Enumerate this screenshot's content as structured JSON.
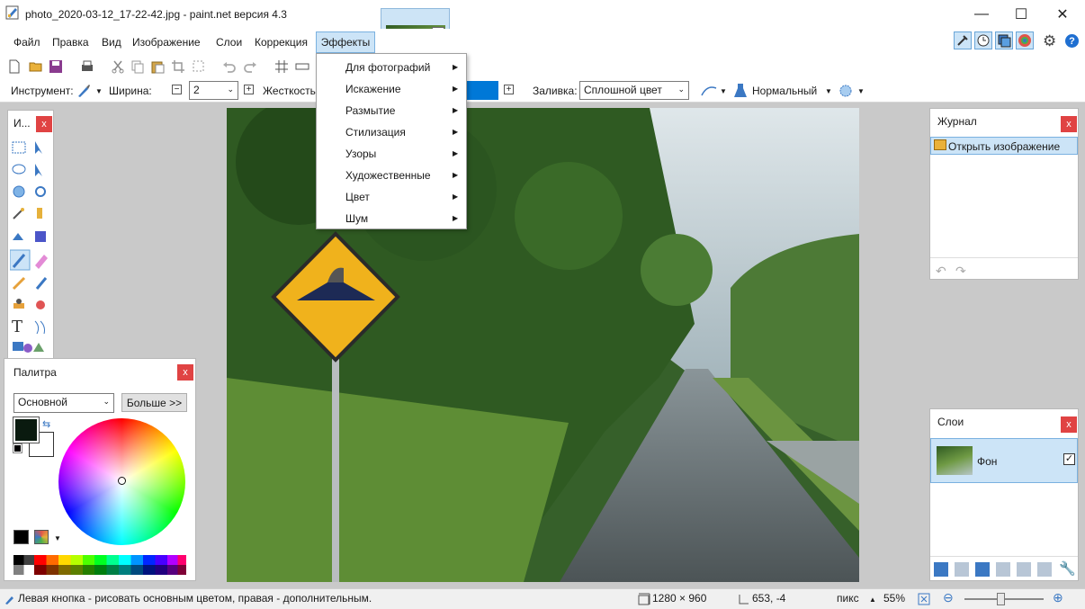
{
  "window": {
    "title": "photo_2020-03-12_17-22-42.jpg - paint.net версия 4.3",
    "controls": {
      "minimize": "—",
      "maximize": "☐",
      "close": "✕"
    }
  },
  "menu": {
    "items": [
      "Файл",
      "Правка",
      "Вид",
      "Изображение",
      "Слои",
      "Коррекция",
      "Эффекты"
    ],
    "active": "Эффекты"
  },
  "effects_menu": {
    "items": [
      {
        "label": "Для фотографий"
      },
      {
        "label": "Искажение"
      },
      {
        "label": "Размытие"
      },
      {
        "label": "Стилизация"
      },
      {
        "label": "Узоры"
      },
      {
        "label": "Художественные"
      },
      {
        "label": "Цвет"
      },
      {
        "label": "Шум"
      }
    ]
  },
  "toolbar2": {
    "tool_label": "Инструмент:",
    "width_label": "Ширина:",
    "width_value": "2",
    "hardness_label": "Жесткость",
    "fill_label": "Заливка:",
    "fill_value": "Сплошной цвет",
    "blend_value": "Нормальный"
  },
  "tools_panel": {
    "title": "И..."
  },
  "palette_panel": {
    "title": "Палитра",
    "palette_select": "Основной",
    "more_button": "Больше >>"
  },
  "history_panel": {
    "title": "Журнал",
    "items": [
      "Открыть изображение"
    ]
  },
  "layers_panel": {
    "title": "Слои",
    "layers": [
      {
        "name": "Фон",
        "visible": true
      }
    ]
  },
  "status": {
    "hint": "Левая кнопка - рисовать основным цветом, правая - дополнительным.",
    "image_size": "1280 × 960",
    "cursor_pos": "653, -4",
    "units": "пикс",
    "zoom": "55%"
  },
  "colors": {
    "accent": "#0078d7",
    "highlight": "#cce4f7",
    "close": "#e04343",
    "primary_color": "#0a1a0f",
    "secondary_color": "#ffffff"
  }
}
